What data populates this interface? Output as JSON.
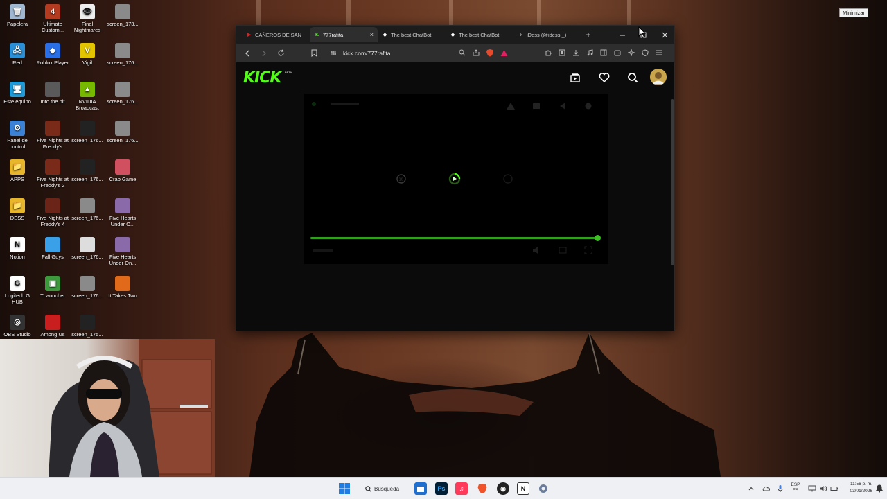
{
  "desktop": {
    "icons": [
      {
        "label": "Papelera",
        "color": "#9fb7d0",
        "glyph": "🗑"
      },
      {
        "label": "Ultimate Custom...",
        "color": "#b33b20",
        "glyph": "4"
      },
      {
        "label": "Final Nightmares",
        "color": "#eeeeee",
        "glyph": "👁"
      },
      {
        "label": "screen_173...",
        "color": "#8a8a8a",
        "glyph": ""
      },
      {
        "label": "Red",
        "color": "#2a8fd6",
        "glyph": "🖧"
      },
      {
        "label": "Roblox Player",
        "color": "#2a6fe6",
        "glyph": "◆"
      },
      {
        "label": "Vigil",
        "color": "#e2c400",
        "glyph": "V"
      },
      {
        "label": "screen_176...",
        "color": "#8a8a8a",
        "glyph": ""
      },
      {
        "label": "Este equipo",
        "color": "#1e9bd8",
        "glyph": "🖥"
      },
      {
        "label": "Into the pit",
        "color": "#5a5a5a",
        "glyph": ""
      },
      {
        "label": "NVIDIA Broadcast",
        "color": "#76b900",
        "glyph": "▲"
      },
      {
        "label": "screen_176...",
        "color": "#8a8a8a",
        "glyph": ""
      },
      {
        "label": "Panel de control",
        "color": "#3b82d6",
        "glyph": "⚙"
      },
      {
        "label": "Five Nights at Freddy's",
        "color": "#7a2a18",
        "glyph": ""
      },
      {
        "label": "screen_176...",
        "color": "#222222",
        "glyph": ""
      },
      {
        "label": "screen_176...",
        "color": "#8a8a8a",
        "glyph": ""
      },
      {
        "label": "APPS",
        "color": "#e8b62a",
        "glyph": "📁"
      },
      {
        "label": "Five Nights at Freddy's 2",
        "color": "#7a2a18",
        "glyph": ""
      },
      {
        "label": "screen_176...",
        "color": "#222222",
        "glyph": ""
      },
      {
        "label": "Crab Game",
        "color": "#d05060",
        "glyph": ""
      },
      {
        "label": "DESS",
        "color": "#e8b62a",
        "glyph": "📁"
      },
      {
        "label": "Five Nights at Freddy's 4",
        "color": "#6a2418",
        "glyph": ""
      },
      {
        "label": "screen_176...",
        "color": "#8a8a8a",
        "glyph": ""
      },
      {
        "label": "Five Hearts Under O...",
        "color": "#8a6aa8",
        "glyph": ""
      },
      {
        "label": "Notion",
        "color": "#ffffff",
        "glyph": "N"
      },
      {
        "label": "Fall Guys",
        "color": "#3aa0e8",
        "glyph": ""
      },
      {
        "label": "screen_176...",
        "color": "#dddddd",
        "glyph": ""
      },
      {
        "label": "Five Hearts Under On...",
        "color": "#8a6aa8",
        "glyph": ""
      },
      {
        "label": "Logitech G HUB",
        "color": "#ffffff",
        "glyph": "G"
      },
      {
        "label": "TLauncher",
        "color": "#3c9a3c",
        "glyph": "▣"
      },
      {
        "label": "screen_176...",
        "color": "#8a8a8a",
        "glyph": ""
      },
      {
        "label": "It Takes Two",
        "color": "#e06a1a",
        "glyph": ""
      },
      {
        "label": "OBS Studio",
        "color": "#333333",
        "glyph": "◎"
      },
      {
        "label": "Among Us",
        "color": "#c81e1e",
        "glyph": ""
      },
      {
        "label": "screen_175...",
        "color": "#222222",
        "glyph": ""
      }
    ]
  },
  "browser": {
    "tabs": [
      {
        "label": "CAÑEROS DE SAN",
        "fav": "▶",
        "favcolor": "#e02020",
        "active": false
      },
      {
        "label": "777rafita",
        "fav": "K",
        "favcolor": "#53fc18",
        "active": true
      },
      {
        "label": "The best ChatBot",
        "fav": "◆",
        "favcolor": "#ffffff",
        "active": false
      },
      {
        "label": "The best ChatBot",
        "fav": "◆",
        "favcolor": "#ffffff",
        "active": false
      },
      {
        "label": "iDess (@idess._)",
        "fav": "♪",
        "favcolor": "#ffffff",
        "active": false
      }
    ],
    "url": "kick.com/777rafita",
    "page": {
      "logo": "KICK",
      "beta": "BETA",
      "progress": 0.99
    }
  },
  "tooltip": "Minimizar",
  "taskbar": {
    "search_label": "Búsqueda",
    "lang_top": "ESP",
    "lang_bottom": "ES",
    "time": "11:56 p. m.",
    "date": "03/01/2026"
  },
  "colors": {
    "kick_green": "#53fc18",
    "progress_green": "#2fa01a"
  }
}
